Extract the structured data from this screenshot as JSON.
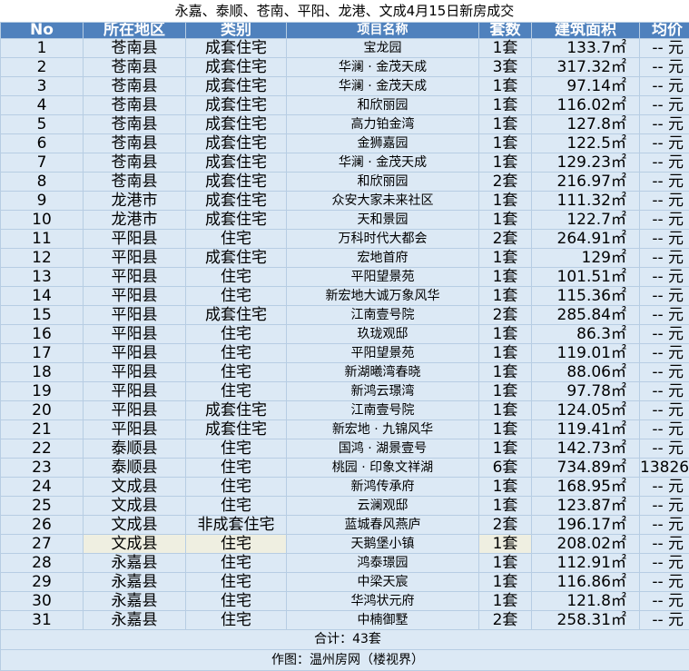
{
  "title": "永嘉、泰顺、苍南、平阳、龙港、文成4月15日新房成交",
  "headers": [
    "No",
    "所在地区",
    "类别",
    "项目名称",
    "套数",
    "建筑面积",
    "均价"
  ],
  "rows": [
    {
      "no": "1",
      "district": "苍南县",
      "type": "成套住宅",
      "project": "宝龙园",
      "count": "1套",
      "area": "133.7㎡",
      "price": "-- 元"
    },
    {
      "no": "2",
      "district": "苍南县",
      "type": "成套住宅",
      "project": "华澜 · 金茂天成",
      "count": "3套",
      "area": "317.32㎡",
      "price": "-- 元"
    },
    {
      "no": "3",
      "district": "苍南县",
      "type": "成套住宅",
      "project": "华澜 · 金茂天成",
      "count": "1套",
      "area": "97.14㎡",
      "price": "-- 元"
    },
    {
      "no": "4",
      "district": "苍南县",
      "type": "成套住宅",
      "project": "和欣丽园",
      "count": "1套",
      "area": "116.02㎡",
      "price": "-- 元"
    },
    {
      "no": "5",
      "district": "苍南县",
      "type": "成套住宅",
      "project": "高力铂金湾",
      "count": "1套",
      "area": "127.8㎡",
      "price": "-- 元"
    },
    {
      "no": "6",
      "district": "苍南县",
      "type": "成套住宅",
      "project": "金狮嘉园",
      "count": "1套",
      "area": "122.5㎡",
      "price": "-- 元"
    },
    {
      "no": "7",
      "district": "苍南县",
      "type": "成套住宅",
      "project": "华澜 · 金茂天成",
      "count": "1套",
      "area": "129.23㎡",
      "price": "-- 元"
    },
    {
      "no": "8",
      "district": "苍南县",
      "type": "成套住宅",
      "project": "和欣丽园",
      "count": "2套",
      "area": "216.97㎡",
      "price": "-- 元"
    },
    {
      "no": "9",
      "district": "龙港市",
      "type": "成套住宅",
      "project": "众安大家未来社区",
      "count": "1套",
      "area": "111.32㎡",
      "price": "-- 元"
    },
    {
      "no": "10",
      "district": "龙港市",
      "type": "成套住宅",
      "project": "天和景园",
      "count": "1套",
      "area": "122.7㎡",
      "price": "-- 元"
    },
    {
      "no": "11",
      "district": "平阳县",
      "type": "住宅",
      "project": "万科时代大都会",
      "count": "2套",
      "area": "264.91㎡",
      "price": "-- 元"
    },
    {
      "no": "12",
      "district": "平阳县",
      "type": "成套住宅",
      "project": "宏地首府",
      "count": "1套",
      "area": "129㎡",
      "price": "-- 元"
    },
    {
      "no": "13",
      "district": "平阳县",
      "type": "住宅",
      "project": "平阳望景苑",
      "count": "1套",
      "area": "101.51㎡",
      "price": "-- 元"
    },
    {
      "no": "14",
      "district": "平阳县",
      "type": "住宅",
      "project": "新宏地大诚万象风华",
      "count": "1套",
      "area": "115.36㎡",
      "price": "-- 元"
    },
    {
      "no": "15",
      "district": "平阳县",
      "type": "成套住宅",
      "project": "江南壹号院",
      "count": "2套",
      "area": "285.84㎡",
      "price": "-- 元"
    },
    {
      "no": "16",
      "district": "平阳县",
      "type": "住宅",
      "project": "玖珑观邸",
      "count": "1套",
      "area": "86.3㎡",
      "price": "-- 元"
    },
    {
      "no": "17",
      "district": "平阳县",
      "type": "住宅",
      "project": "平阳望景苑",
      "count": "1套",
      "area": "119.01㎡",
      "price": "-- 元"
    },
    {
      "no": "18",
      "district": "平阳县",
      "type": "住宅",
      "project": "新湖曦湾春晓",
      "count": "1套",
      "area": "88.06㎡",
      "price": "-- 元"
    },
    {
      "no": "19",
      "district": "平阳县",
      "type": "住宅",
      "project": "新鸿云璟湾",
      "count": "1套",
      "area": "97.78㎡",
      "price": "-- 元"
    },
    {
      "no": "20",
      "district": "平阳县",
      "type": "成套住宅",
      "project": "江南壹号院",
      "count": "1套",
      "area": "124.05㎡",
      "price": "-- 元"
    },
    {
      "no": "21",
      "district": "平阳县",
      "type": "成套住宅",
      "project": "新宏地 · 九锦风华",
      "count": "1套",
      "area": "119.41㎡",
      "price": "-- 元"
    },
    {
      "no": "22",
      "district": "泰顺县",
      "type": "住宅",
      "project": "国鸿 · 湖景壹号",
      "count": "1套",
      "area": "142.73㎡",
      "price": "-- 元"
    },
    {
      "no": "23",
      "district": "泰顺县",
      "type": "住宅",
      "project": "桃园 · 印象文祥湖",
      "count": "6套",
      "area": "734.89㎡",
      "price": "13826"
    },
    {
      "no": "24",
      "district": "文成县",
      "type": "住宅",
      "project": "新鸿传承府",
      "count": "1套",
      "area": "168.95㎡",
      "price": "-- 元"
    },
    {
      "no": "25",
      "district": "文成县",
      "type": "住宅",
      "project": "云澜观邸",
      "count": "1套",
      "area": "123.87㎡",
      "price": "-- 元"
    },
    {
      "no": "26",
      "district": "文成县",
      "type": "非成套住宅",
      "project": "蓝城春风燕庐",
      "count": "2套",
      "area": "196.17㎡",
      "price": "-- 元"
    },
    {
      "no": "27",
      "district": "文成县",
      "type": "住宅",
      "project": "天鹅堡小镇",
      "count": "1套",
      "area": "208.02㎡",
      "price": "-- 元"
    },
    {
      "no": "28",
      "district": "永嘉县",
      "type": "住宅",
      "project": "鸿泰璟园",
      "count": "1套",
      "area": "112.91㎡",
      "price": "-- 元"
    },
    {
      "no": "29",
      "district": "永嘉县",
      "type": "住宅",
      "project": "中梁天宸",
      "count": "1套",
      "area": "116.86㎡",
      "price": "-- 元"
    },
    {
      "no": "30",
      "district": "永嘉县",
      "type": "住宅",
      "project": "华鸿状元府",
      "count": "1套",
      "area": "121.8㎡",
      "price": "-- 元"
    },
    {
      "no": "31",
      "district": "永嘉县",
      "type": "住宅",
      "project": "中楠御墅",
      "count": "2套",
      "area": "258.31㎡",
      "price": "-- 元"
    }
  ],
  "highlighted_row_index": 26,
  "total": "合计：43套",
  "credit": "作图：温州房网（楼视界）",
  "colors": {
    "header_bg": "#4f81bd",
    "row_bg": "#dce9f5",
    "highlight_bg": "#efefe1"
  }
}
